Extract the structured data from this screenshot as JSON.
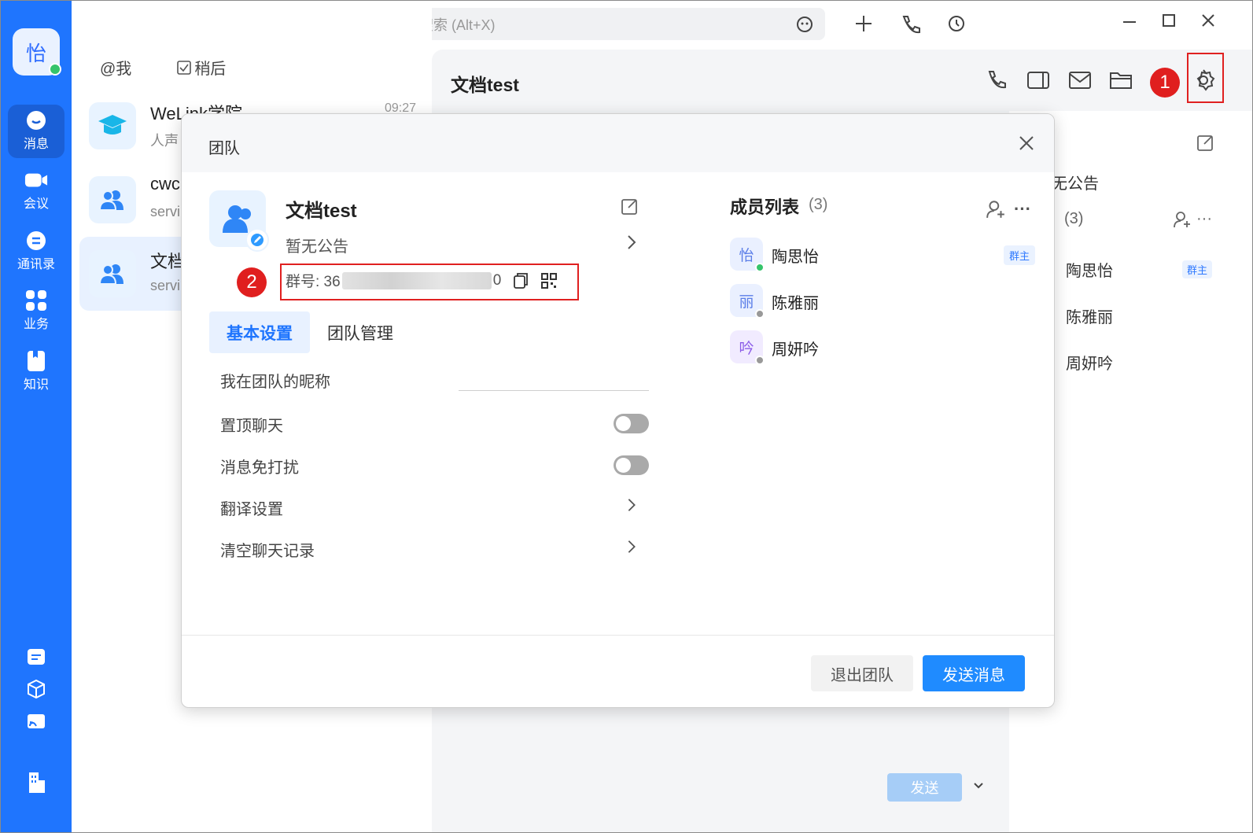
{
  "user": {
    "avatar_char": "怡"
  },
  "rail": {
    "items": [
      {
        "label": "消息"
      },
      {
        "label": "会议"
      },
      {
        "label": "通讯录"
      },
      {
        "label": "业务"
      },
      {
        "label": "知识"
      }
    ]
  },
  "filters": {
    "mention": "@我",
    "later": "稍后"
  },
  "chats": [
    {
      "name": "WeLink学院",
      "preview": "人声",
      "time": "09:27"
    },
    {
      "name": "cwc",
      "preview": "servi"
    },
    {
      "name": "文档",
      "preview": "servi"
    }
  ],
  "search": {
    "placeholder": "搜索 (Alt+X)"
  },
  "main": {
    "title": "文档test",
    "send_label": "发送"
  },
  "annotations": {
    "one": "1",
    "two": "2"
  },
  "right_panel": {
    "notice": "无公告",
    "members_count": "(3)",
    "members": [
      {
        "name": "陶思怡",
        "tag": "群主"
      },
      {
        "name": "陈雅丽"
      },
      {
        "name": "周妍吟"
      }
    ]
  },
  "modal": {
    "title": "团队",
    "group_name": "文档test",
    "notice": "暂无公告",
    "group_id_prefix": "群号: 36",
    "group_id_suffix": "0",
    "tabs": [
      "基本设置",
      "团队管理"
    ],
    "settings": [
      {
        "label": "我在团队的昵称"
      },
      {
        "label": "置顶聊天",
        "toggle": false
      },
      {
        "label": "消息免打扰",
        "toggle": false
      },
      {
        "label": "翻译设置"
      },
      {
        "label": "清空聊天记录"
      }
    ],
    "members_title": "成员列表",
    "members_count": "(3)",
    "members": [
      {
        "avatar": "怡",
        "name": "陶思怡",
        "tag": "群主",
        "online": true
      },
      {
        "avatar": "丽",
        "name": "陈雅丽",
        "online": false
      },
      {
        "avatar": "吟",
        "name": "周妍吟",
        "online": false
      }
    ],
    "exit_label": "退出团队",
    "send_label": "发送消息"
  }
}
